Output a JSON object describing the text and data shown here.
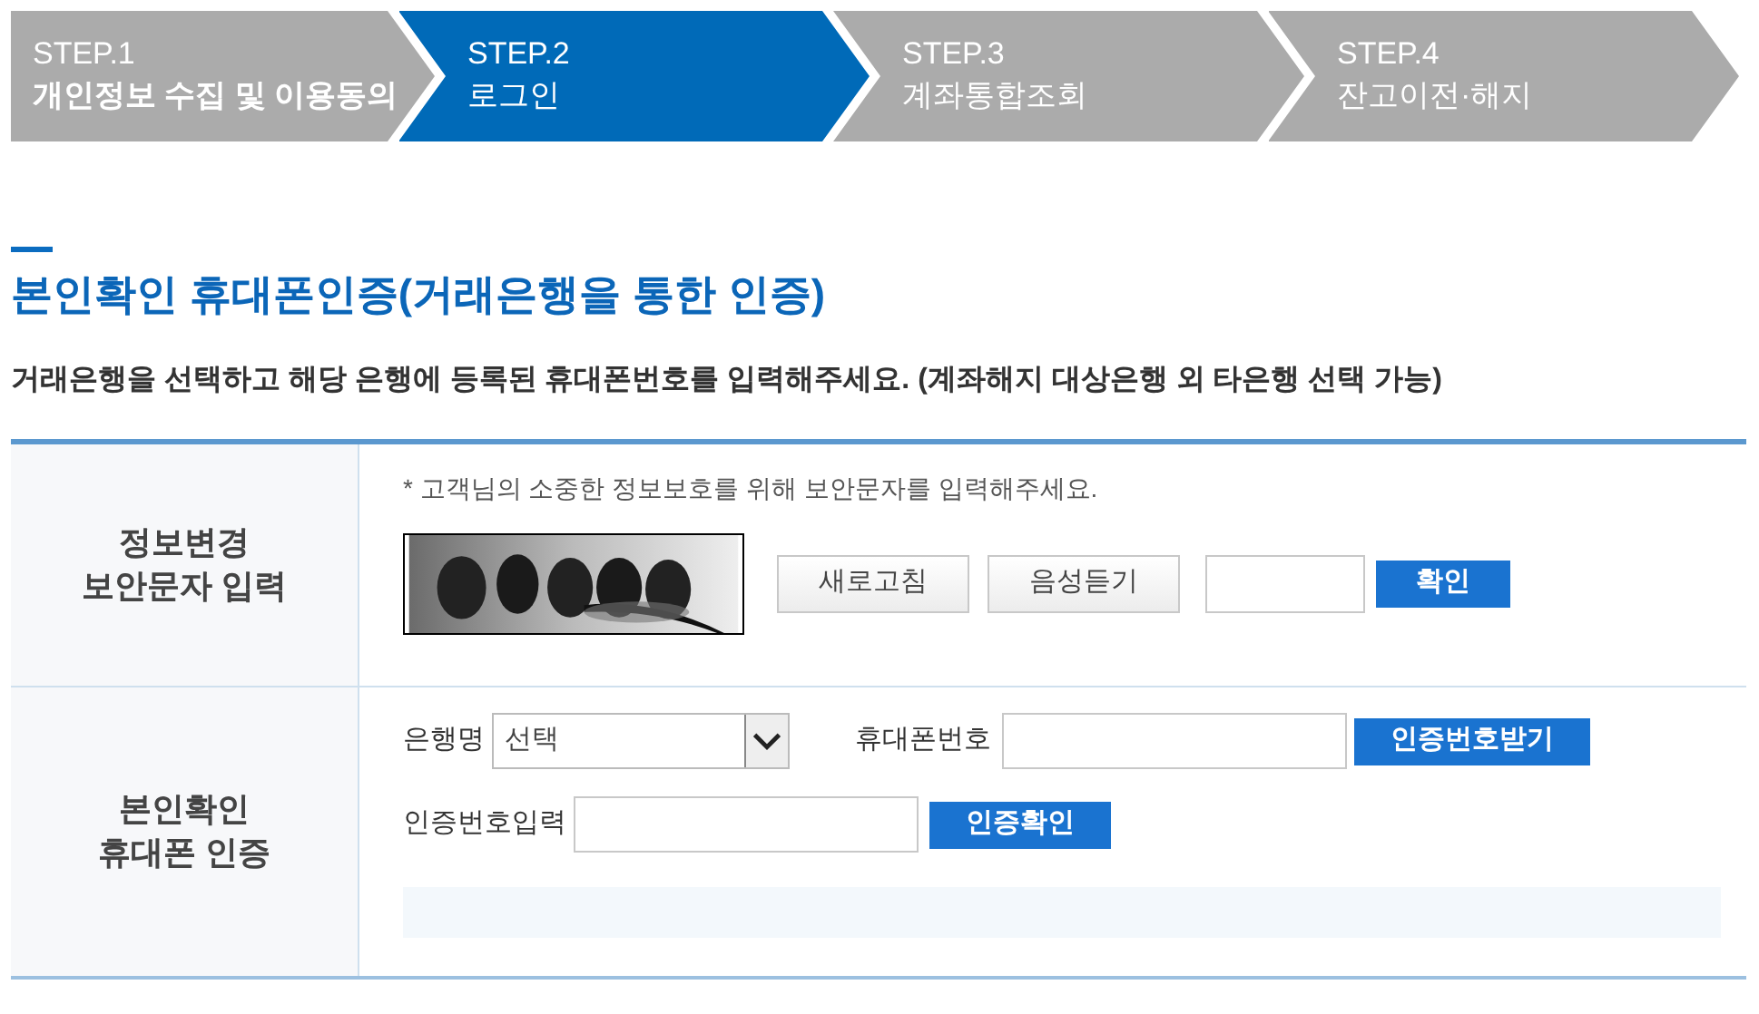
{
  "steps": [
    {
      "label": "STEP.1",
      "title": "개인정보 수집 및 이용동의",
      "selected": false,
      "completed": true
    },
    {
      "label": "STEP.2",
      "title": "로그인",
      "selected": true,
      "completed": false
    },
    {
      "label": "STEP.3",
      "title": "계좌통합조회",
      "selected": false,
      "completed": false
    },
    {
      "label": "STEP.4",
      "title": "잔고이전·해지",
      "selected": false,
      "completed": false
    }
  ],
  "heading": "본인확인 휴대폰인증(거래은행을 통한 인증)",
  "instruction": "거래은행을 선택하고 해당 은행에 등록된 휴대폰번호를 입력해주세요. (계좌해지 대상은행 외 타은행 선택 가능)",
  "captcha_section": {
    "label": "정보변경\n보안문자 입력",
    "note": "* 고객님의 소중한 정보보호를 위해 보안문자를 입력해주세요.",
    "refresh_button": "새로고침",
    "audio_button": "음성듣기",
    "confirm_button": "확인"
  },
  "phone_section": {
    "label": "본인확인\n휴대폰 인증",
    "bank_label": "은행명",
    "bank_select": "선택",
    "phone_label": "휴대폰번호",
    "request_button": "인증번호받기",
    "code_label": "인증번호입력",
    "verify_button": "인증확인"
  }
}
